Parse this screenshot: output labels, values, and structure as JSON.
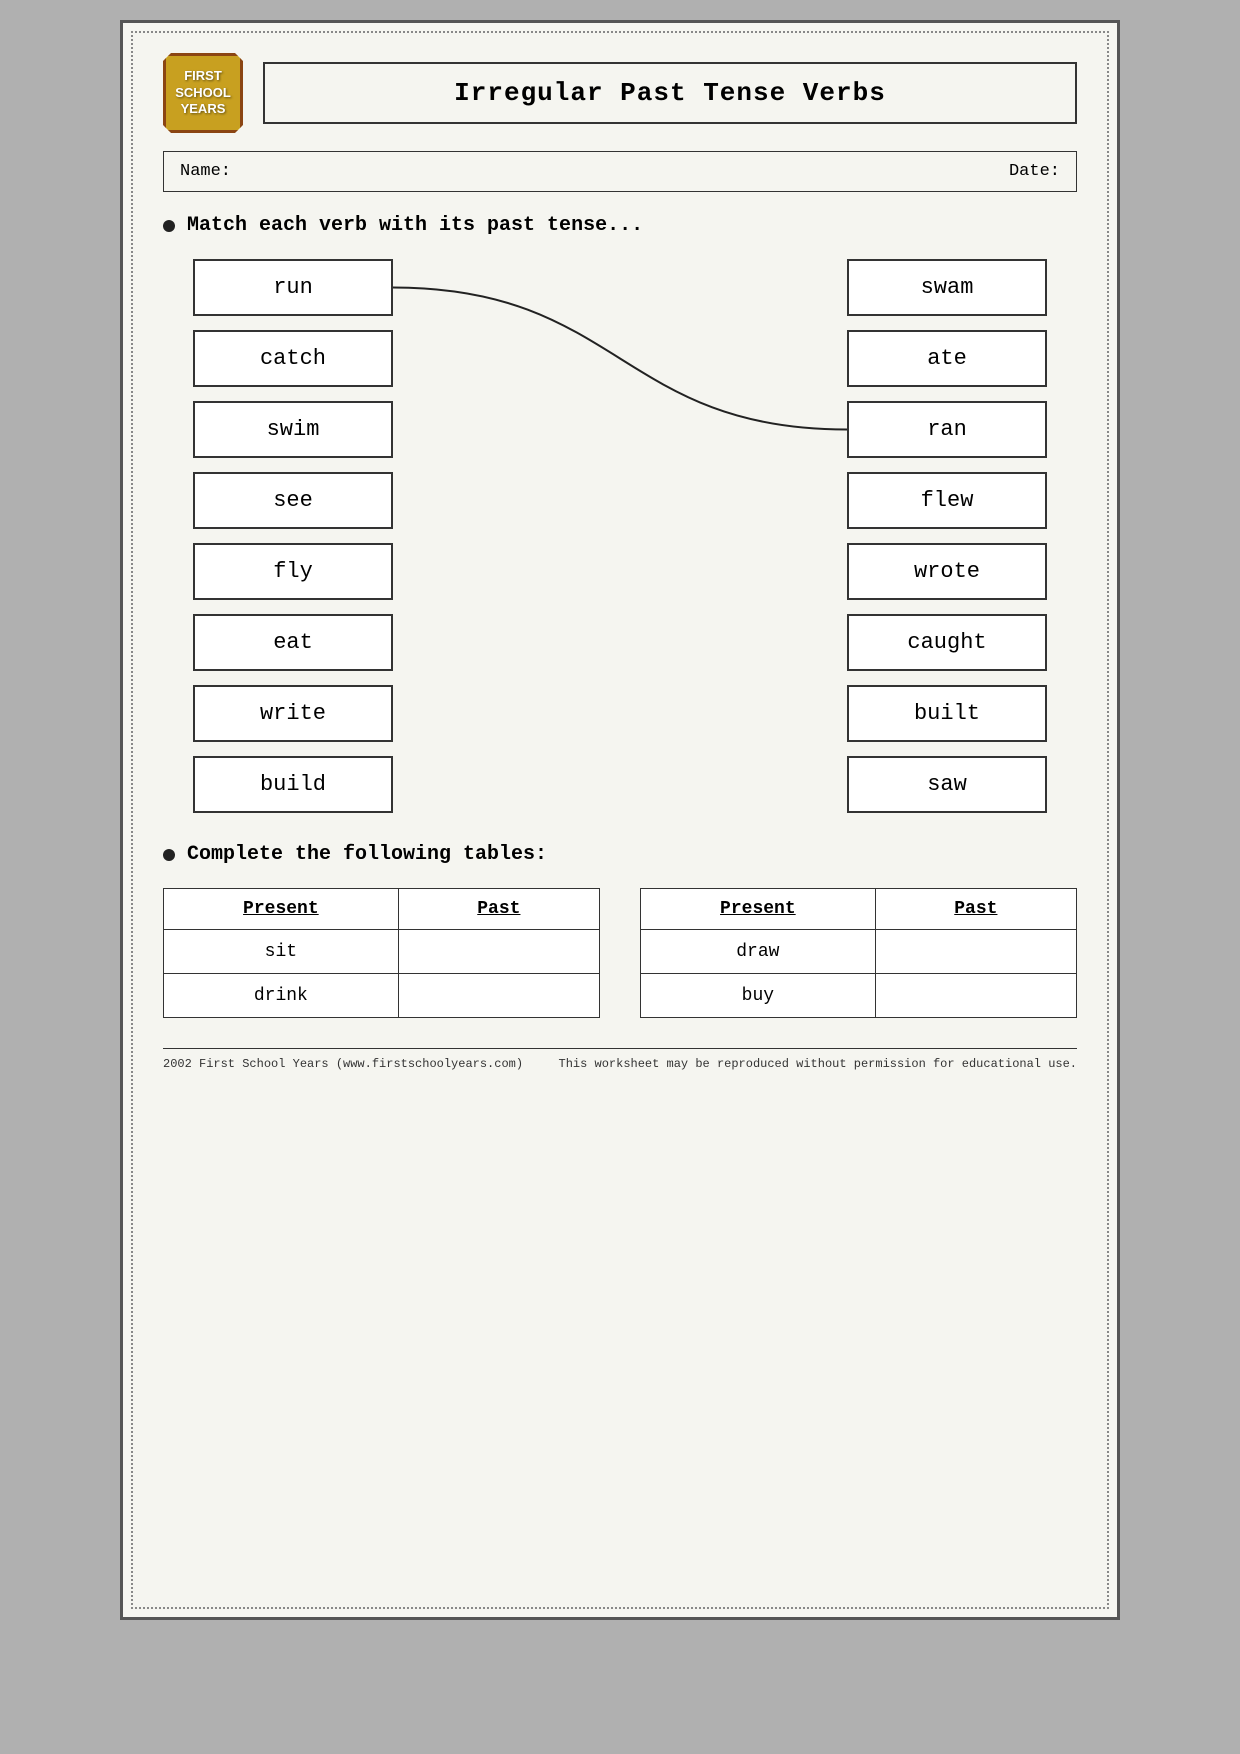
{
  "header": {
    "logo": {
      "line1": "FIRST",
      "line2": "SCHOOL",
      "line3": "YEARS"
    },
    "title": "Irregular Past Tense Verbs"
  },
  "nameDate": {
    "nameLabel": "Name:",
    "dateLabel": "Date:"
  },
  "instruction1": "Match each verb with its past tense...",
  "leftColumn": [
    "run",
    "catch",
    "swim",
    "see",
    "fly",
    "eat",
    "write",
    "build"
  ],
  "rightColumn": [
    "swam",
    "ate",
    "ran",
    "flew",
    "wrote",
    "caught",
    "built",
    "saw"
  ],
  "instruction2": "Complete the following tables:",
  "table1": {
    "headers": [
      "Present",
      "Past"
    ],
    "rows": [
      [
        "sit",
        ""
      ],
      [
        "drink",
        ""
      ]
    ]
  },
  "table2": {
    "headers": [
      "Present",
      "Past"
    ],
    "rows": [
      [
        "draw",
        ""
      ],
      [
        "buy",
        ""
      ]
    ]
  },
  "footer": {
    "left": "2002 First School Years  (www.firstschoolyears.com)",
    "right": "This worksheet may be reproduced without permission for educational use."
  }
}
